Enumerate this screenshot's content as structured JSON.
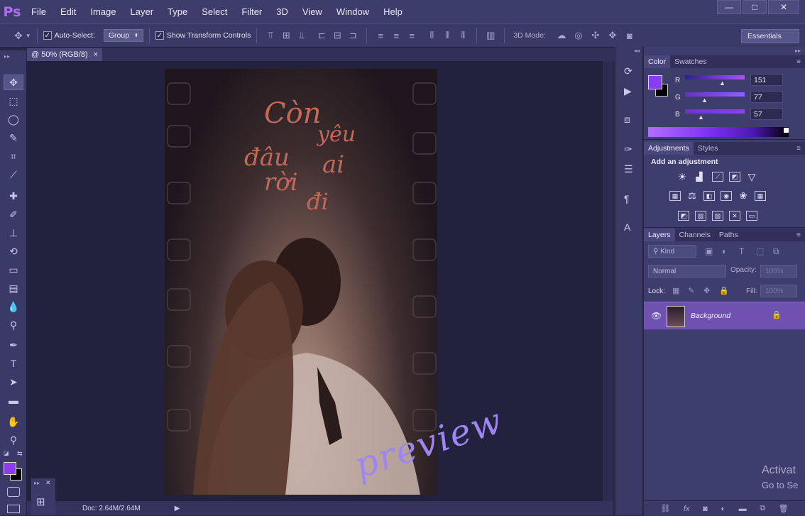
{
  "app": {
    "logo": "Ps"
  },
  "menu": [
    "File",
    "Edit",
    "Image",
    "Layer",
    "Type",
    "Select",
    "Filter",
    "3D",
    "View",
    "Window",
    "Help"
  ],
  "window_controls": {
    "minimize": "—",
    "maximize": "□",
    "close": "✕"
  },
  "options": {
    "auto_select_label": "Auto-Select:",
    "auto_select_value": "Group",
    "show_transform_label": "Show Transform Controls",
    "mode_3d_label": "3D Mode:",
    "workspace": "Essentials"
  },
  "document": {
    "tab_title": "@ 50% (RGB/8)",
    "tab_close": "×",
    "doc_size": "Doc: 2.64M/2.64M",
    "poster_title_lines": [
      "Còn",
      "yêu",
      "đâu",
      "ai",
      "rời",
      "đi"
    ],
    "preview_text": "preview"
  },
  "color_panel": {
    "tabs": [
      "Color",
      "Swatches"
    ],
    "active_tab": "Color",
    "foreground": "#974d39",
    "channels": [
      {
        "label": "R",
        "value": "151"
      },
      {
        "label": "G",
        "value": "77"
      },
      {
        "label": "B",
        "value": "57"
      }
    ]
  },
  "adjustments_panel": {
    "tabs": [
      "Adjustments",
      "Styles"
    ],
    "active_tab": "Adjustments",
    "heading": "Add an adjustment"
  },
  "layers_panel": {
    "tabs": [
      "Layers",
      "Channels",
      "Paths"
    ],
    "active_tab": "Layers",
    "kind_label": "Kind",
    "blend_mode": "Normal",
    "opacity_label": "Opacity:",
    "opacity_value": "100%",
    "lock_label": "Lock:",
    "fill_label": "Fill:",
    "fill_value": "100%",
    "layers": [
      {
        "name": "Background",
        "locked": true,
        "visible": true
      }
    ]
  },
  "watermark": {
    "line1": "Activat",
    "line2": "Go to Se"
  },
  "colors": {
    "accent": "#8a3df0",
    "menubar": "#3d3d6b",
    "panel": "#3e3e6e",
    "canvas_bg": "#22223f",
    "poster_text": "#c26a58",
    "preview_script": "#9d86f2"
  }
}
